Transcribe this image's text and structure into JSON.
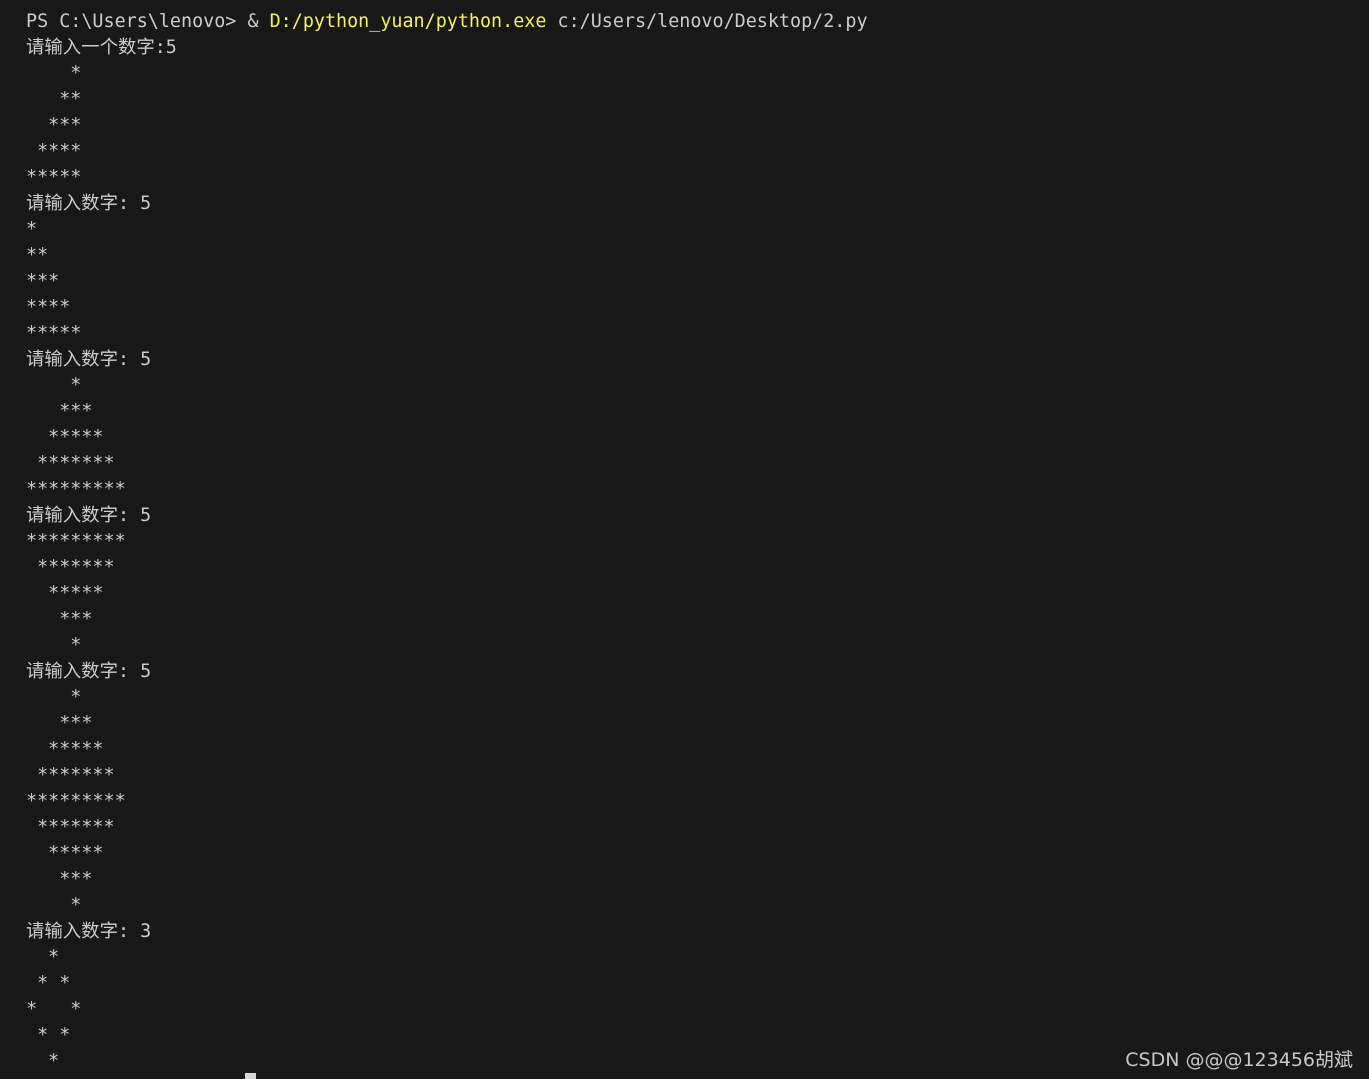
{
  "terminal": {
    "prompt_line": {
      "prompt": "PS C:\\Users\\lenovo> ",
      "operator": "& ",
      "executable": "D:/python_yuan/python.exe",
      "script": " c:/Users/lenovo/Desktop/2.py"
    },
    "output_lines": [
      "请输入一个数字:5",
      "    *",
      "   **",
      "  ***",
      " ****",
      "*****",
      "请输入数字: 5",
      "*",
      "**",
      "***",
      "****",
      "*****",
      "请输入数字: 5",
      "    *",
      "   ***",
      "  *****",
      " *******",
      "*********",
      "请输入数字: 5",
      "*********",
      " *******",
      "  *****",
      "   ***",
      "    *",
      "请输入数字: 5",
      "    *",
      "   ***",
      "  *****",
      " *******",
      "*********",
      " *******",
      "  *****",
      "   ***",
      "    *",
      "请输入数字: 3",
      "  *",
      " * *",
      "*   *",
      " * *",
      "  *"
    ],
    "colors": {
      "background": "#181818",
      "text": "#cccccc",
      "executable": "#f2f25b"
    }
  },
  "watermark": "CSDN @@@123456胡斌"
}
